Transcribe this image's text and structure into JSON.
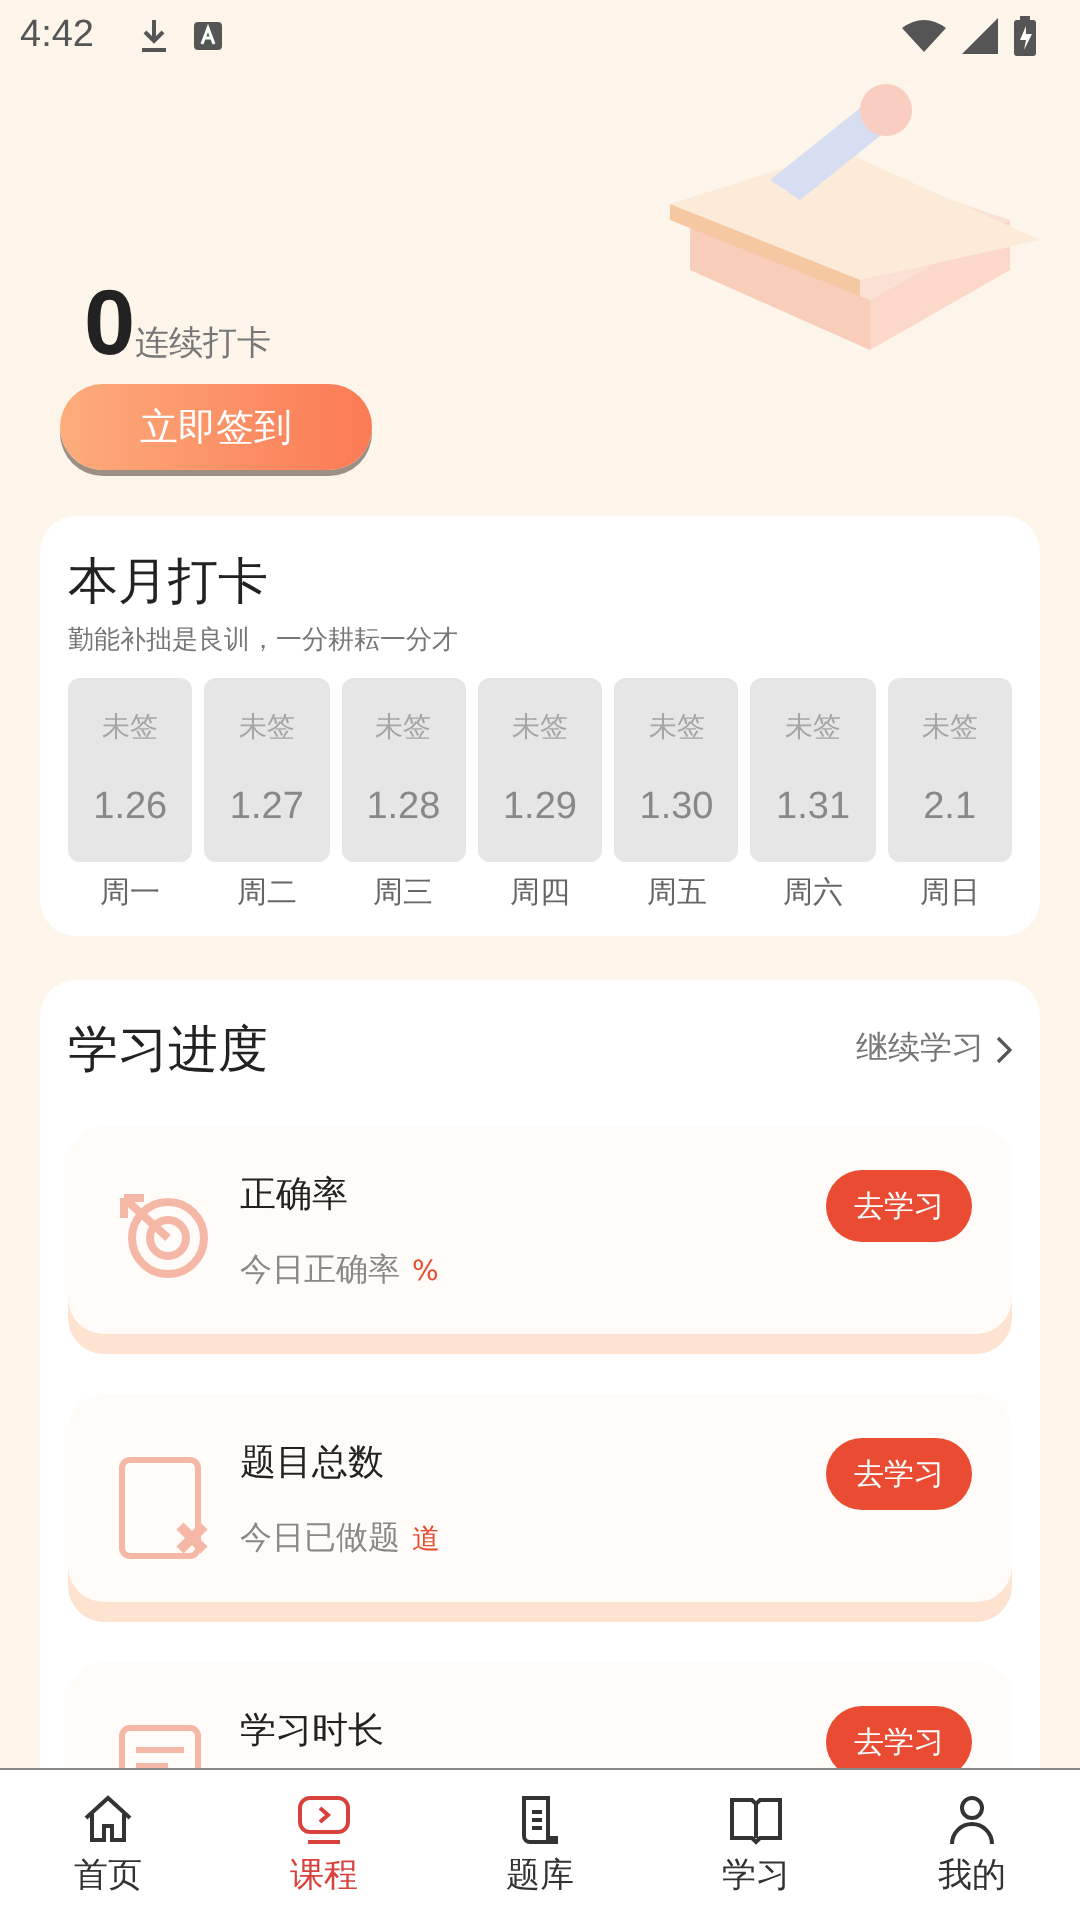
{
  "status_bar": {
    "time": "4:42"
  },
  "streak": {
    "count": "0",
    "label": "连续打卡",
    "button": "立即签到"
  },
  "month_card": {
    "title": "本月打卡",
    "subtitle": "勤能补拙是良训，一分耕耘一分才",
    "days": [
      {
        "status": "未签",
        "date": "1.26",
        "weekday": "周一",
        "signed": false
      },
      {
        "status": "未签",
        "date": "1.27",
        "weekday": "周二",
        "signed": false
      },
      {
        "status": "未签",
        "date": "1.28",
        "weekday": "周三",
        "signed": false
      },
      {
        "status": "未签",
        "date": "1.29",
        "weekday": "周四",
        "signed": false
      },
      {
        "status": "未签",
        "date": "1.30",
        "weekday": "周五",
        "signed": false
      },
      {
        "status": "未签",
        "date": "1.31",
        "weekday": "周六",
        "signed": false
      },
      {
        "status": "未签",
        "date": "2.1",
        "weekday": "周日",
        "signed": false
      }
    ]
  },
  "progress": {
    "title": "学习进度",
    "link": "继续学习",
    "items": [
      {
        "kind": "target",
        "title": "正确率",
        "subtitle": "今日正确率",
        "unit": "%",
        "button": "去学习"
      },
      {
        "kind": "wrong",
        "title": "题目总数",
        "subtitle": "今日已做题",
        "unit": "道",
        "button": "去学习"
      },
      {
        "kind": "time",
        "title": "学习时长",
        "button": "去学习"
      }
    ]
  },
  "tab_bar": [
    {
      "kind": "home",
      "label": "首页",
      "selected": false
    },
    {
      "kind": "course",
      "label": "课程",
      "selected": true
    },
    {
      "kind": "bank",
      "label": "题库",
      "selected": false
    },
    {
      "kind": "study",
      "label": "学习",
      "selected": false
    },
    {
      "kind": "me",
      "label": "我的",
      "selected": false
    }
  ]
}
